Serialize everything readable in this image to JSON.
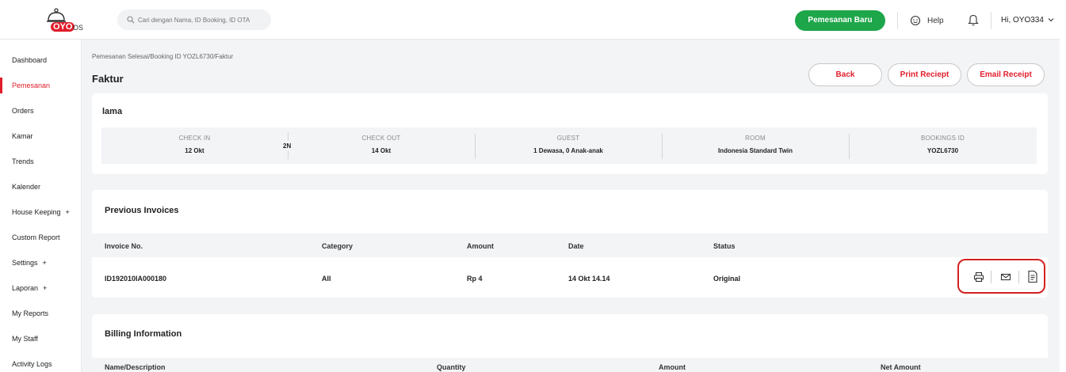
{
  "header": {
    "logo_brand": "OYO",
    "logo_suffix": "OS",
    "search_placeholder": "Cari dengan Nama, ID Booking, ID OTA",
    "new_booking_label": "Pemesanan Baru",
    "help_label": "Help",
    "user_label": "Hi, OYO334"
  },
  "sidebar": {
    "items": [
      {
        "label": "Dashboard"
      },
      {
        "label": "Pemesanan"
      },
      {
        "label": "Orders"
      },
      {
        "label": "Kamar"
      },
      {
        "label": "Trends"
      },
      {
        "label": "Kalender"
      },
      {
        "label": "House Keeping",
        "plus": "+"
      },
      {
        "label": "Custom Report"
      },
      {
        "label": "Settings",
        "plus": "+"
      },
      {
        "label": "Laporan",
        "plus": "+"
      },
      {
        "label": "My Reports"
      },
      {
        "label": "My Staff"
      },
      {
        "label": "Activity Logs"
      }
    ]
  },
  "page": {
    "breadcrumb": "Pemesanan Selesai/Booking ID YOZL6730/Faktur",
    "title": "Faktur",
    "back_label": "Back",
    "print_label": "Print Reciept",
    "email_label": "Email Receipt"
  },
  "booking": {
    "guest_name": "lama",
    "checkin_label": "CHECK IN",
    "checkin_value": "12 Okt",
    "nights": "2N",
    "checkout_label": "CHECK OUT",
    "checkout_value": "14 Okt",
    "guest_label": "GUEST",
    "guest_value": "1 Dewasa, 0 Anak-anak",
    "room_label": "ROOM",
    "room_value": "Indonesia Standard Twin",
    "bookingid_label": "BOOKINGS ID",
    "bookingid_value": "YOZL6730"
  },
  "invoices": {
    "title": "Previous Invoices",
    "columns": [
      "Invoice No.",
      "Category",
      "Amount",
      "Date",
      "Status"
    ],
    "rows": [
      {
        "invoice_no": "ID192010IA000180",
        "category": "All",
        "amount": "Rp 4",
        "date": "14 Okt 14.14",
        "status": "Original"
      }
    ],
    "action_icons": [
      "printer-icon",
      "mail-icon",
      "document-icon"
    ]
  },
  "billing": {
    "title": "Billing Information",
    "columns": [
      "Name/Description",
      "Quantity",
      "Amount",
      "Net Amount"
    ]
  },
  "colors": {
    "brand_red": "#e21d2b",
    "green": "#1ea64a",
    "highlight": "#d42121"
  }
}
